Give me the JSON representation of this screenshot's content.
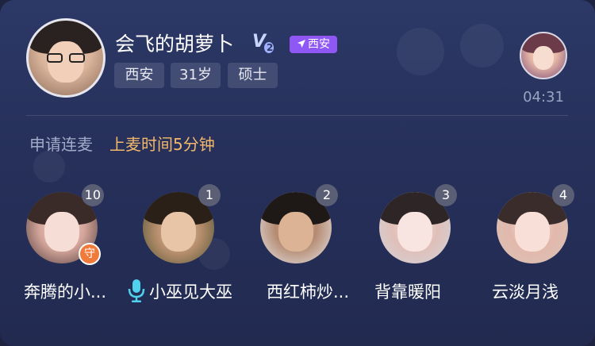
{
  "host": {
    "name": "会飞的胡萝卜",
    "level_badge": "V",
    "level_num": "2",
    "location_badge": "西安",
    "tags": [
      "西安",
      "31岁",
      "硕士"
    ]
  },
  "guest": {
    "timer": "04:31"
  },
  "apply": {
    "label": "申请连麦",
    "time_text": "上麦时间5分钟"
  },
  "queue": [
    {
      "name": "奔腾的小...",
      "number": "10",
      "guard_label": "守"
    },
    {
      "name": "小巫见大巫",
      "number": "1",
      "speaking": true
    },
    {
      "name": "西红柿炒...",
      "number": "2"
    },
    {
      "name": "背靠暖阳",
      "number": "3"
    },
    {
      "name": "云淡月浅",
      "number": "4"
    }
  ],
  "colors": {
    "accent_orange": "#f3b86b",
    "badge_purple": "#8f58f5",
    "mic_cyan": "#4fd2f0",
    "guard_orange": "#f07a3a"
  }
}
